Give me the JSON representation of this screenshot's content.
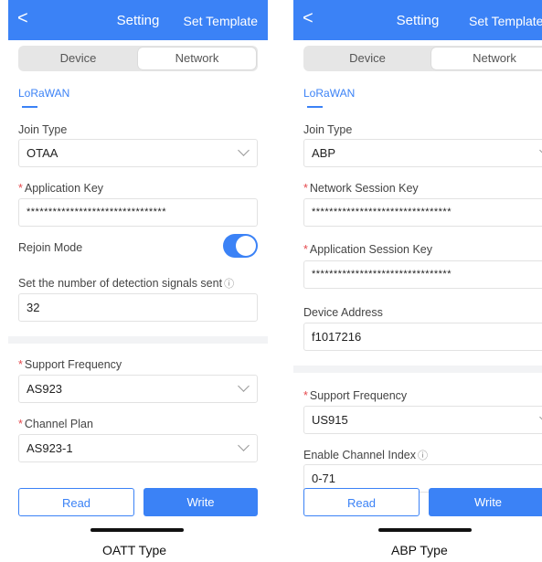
{
  "left_screen": {
    "header": {
      "back_glyph": "<",
      "title": "Setting",
      "template_label": "Set Template"
    },
    "segment": {
      "device": "Device",
      "network": "Network"
    },
    "tab": "LoRaWAN",
    "join_type": {
      "label": "Join Type",
      "value": "OTAA"
    },
    "application_key": {
      "label": "Application Key",
      "value": "********************************"
    },
    "rejoin_mode": {
      "label": "Rejoin Mode",
      "enabled": true
    },
    "detection_signals": {
      "label": "Set the number of detection signals  sent",
      "info_glyph": "ⓘ",
      "value": "32"
    },
    "support_frequency": {
      "label": "Support Frequency",
      "value": "AS923"
    },
    "channel_plan": {
      "label": "Channel Plan",
      "value": "AS923-1"
    },
    "buttons": {
      "read": "Read",
      "write": "Write"
    }
  },
  "right_screen": {
    "header": {
      "back_glyph": "<",
      "title": "Setting",
      "template_label": "Set Template"
    },
    "segment": {
      "device": "Device",
      "network": "Network"
    },
    "tab": "LoRaWAN",
    "join_type": {
      "label": "Join Type",
      "value": "ABP"
    },
    "network_session_key": {
      "label": "Network Session Key",
      "value": "********************************"
    },
    "application_session_key": {
      "label": "Application Session Key",
      "value": "********************************"
    },
    "device_address": {
      "label": "Device Address",
      "value": "f1017216"
    },
    "support_frequency": {
      "label": "Support Frequency",
      "value": "US915"
    },
    "channel_index": {
      "label": "Enable Channel Index",
      "info_glyph": "ⓘ",
      "value": "0-71"
    },
    "buttons": {
      "read": "Read",
      "write": "Write"
    }
  },
  "captions": {
    "left": "OATT Type",
    "right": "ABP Type"
  },
  "colors": {
    "accent": "#3b82f6",
    "required": "#e5484d"
  }
}
